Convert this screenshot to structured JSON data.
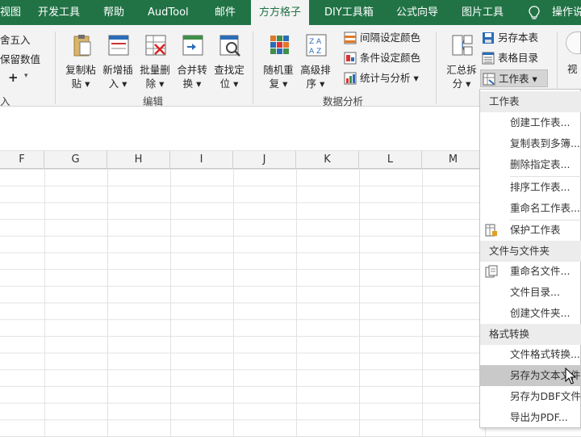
{
  "tabs": [
    {
      "label": "视图"
    },
    {
      "label": "开发工具"
    },
    {
      "label": "帮助"
    },
    {
      "label": "AudTool"
    },
    {
      "label": "邮件"
    },
    {
      "label": "方方格子"
    },
    {
      "label": "DIY工具箱"
    },
    {
      "label": "公式向导"
    },
    {
      "label": "图片工具"
    },
    {
      "label": "操作说"
    }
  ],
  "ribbon": {
    "left_partial": {
      "round_label": "舍五入",
      "keep_value_label": "保留数值",
      "plus_label": "+",
      "group_partial": "入"
    },
    "edit_group": {
      "label": "编辑",
      "buttons": [
        {
          "l1": "复制粘",
          "l2": "贴"
        },
        {
          "l1": "新增插",
          "l2": "入"
        },
        {
          "l1": "批量删",
          "l2": "除"
        },
        {
          "l1": "合并转",
          "l2": "换"
        },
        {
          "l1": "查找定",
          "l2": "位"
        }
      ]
    },
    "analysis_group": {
      "label": "数据分析",
      "buttons": [
        {
          "l1": "随机重",
          "l2": "复"
        },
        {
          "l1": "高级排",
          "l2": "序"
        }
      ],
      "small_buttons": [
        {
          "label": "间隔设定颜色"
        },
        {
          "label": "条件设定颜色"
        },
        {
          "label": "统计与分析"
        }
      ]
    },
    "summary_button": {
      "l1": "汇总拆",
      "l2": "分"
    },
    "right_small": [
      {
        "label": "另存本表"
      },
      {
        "label": "表格目录"
      },
      {
        "label": "工作表"
      }
    ],
    "view_partial": "视"
  },
  "columns": [
    "F",
    "G",
    "H",
    "I",
    "J",
    "K",
    "L",
    "M"
  ],
  "menu": {
    "sections": [
      {
        "title": "工作表",
        "items": [
          {
            "label": "创建工作表..."
          },
          {
            "label": "复制表到多簿..."
          },
          {
            "label": "删除指定表..."
          },
          {
            "label": "排序工作表..."
          },
          {
            "label": "重命名工作表..."
          },
          {
            "label": "保护工作表"
          }
        ]
      },
      {
        "title": "文件与文件夹",
        "items": [
          {
            "label": "重命名文件..."
          },
          {
            "label": "文件目录..."
          },
          {
            "label": "创建文件夹..."
          }
        ]
      },
      {
        "title": "格式转换",
        "items": [
          {
            "label": "文件格式转换..."
          },
          {
            "label": "另存为文本文件"
          },
          {
            "label": "另存为DBF文件"
          },
          {
            "label": "导出为PDF..."
          }
        ]
      }
    ]
  },
  "colors": {
    "excel_green": "#217346",
    "ribbon_bg": "#f3f3f3",
    "menu_highlight": "#c9c9c9"
  }
}
